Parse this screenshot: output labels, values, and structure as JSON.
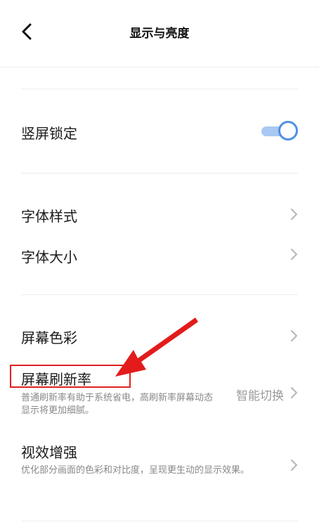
{
  "header": {
    "title": "显示与亮度",
    "back_icon": "chevron-left-icon"
  },
  "rows": {
    "portrait_lock": {
      "label": "竖屏锁定",
      "toggle_on": true
    },
    "font_style": {
      "label": "字体样式"
    },
    "font_size": {
      "label": "字体大小"
    },
    "screen_color": {
      "label": "屏幕色彩"
    },
    "refresh_rate": {
      "label": "屏幕刷新率",
      "subtitle": "普通刷新率有助于系统省电，高刷新率屏幕动态显示将更加细腻。",
      "value": "智能切换"
    },
    "visual_enhance": {
      "label": "视效增强",
      "subtitle": "优化部分画面的色彩和对比度，呈现更生动的显示效果。"
    }
  },
  "annotation": {
    "color": "#e02020"
  },
  "colors": {
    "accent": "#4f8fe6",
    "accent_track": "#a9c8f2",
    "divider": "#ececec"
  }
}
